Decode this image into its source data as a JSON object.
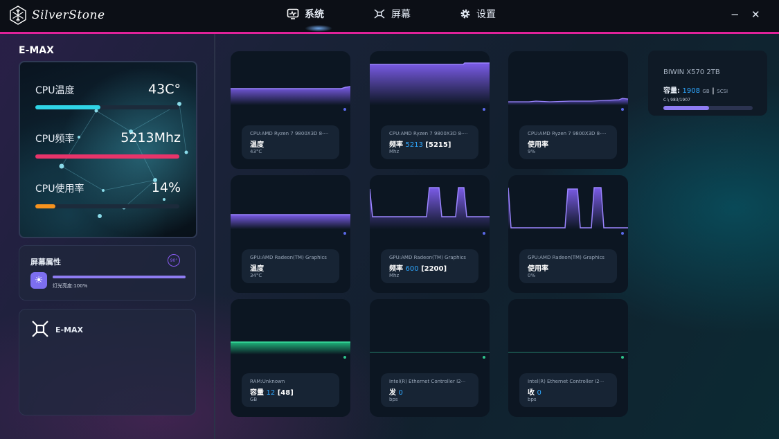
{
  "app": {
    "brand": "SilverStone",
    "colors": {
      "accent": "#e0229a",
      "cyan": "#2fd4e6",
      "pink": "#e8346a",
      "orange": "#f7931e",
      "purple": "#7b5ce8",
      "green": "#1fb47a",
      "blue": "#2fa8ff"
    }
  },
  "nav": {
    "tabs": [
      {
        "label": "系统",
        "icon": "monitor-icon"
      },
      {
        "label": "屏幕",
        "icon": "display-icon"
      },
      {
        "label": "设置",
        "icon": "gear-icon"
      }
    ],
    "active": "系统",
    "minimize": "−",
    "close": "✕"
  },
  "sidebar": {
    "device_title": "E-MAX",
    "cpu": [
      {
        "name": "CPU温度",
        "value": "43C°",
        "level": 0.45
      },
      {
        "name": "CPU频率",
        "value": "5213Mhz",
        "level": 1.0
      },
      {
        "name": "CPU使用率",
        "value": "14%",
        "level": 0.14
      }
    ],
    "screen_props": {
      "title": "屏幕属性",
      "rotate_label": "90°",
      "brightness_label": "灯光亮度:100%",
      "brightness": 1.0
    },
    "device_card": {
      "label": "E-MAX"
    }
  },
  "tiles": [
    {
      "src": "CPU:AMD Ryzen 7 9800X3D 8-···",
      "metric": "温度",
      "value": "",
      "max": "",
      "unit": "43°C"
    },
    {
      "src": "CPU:AMD Ryzen 7 9800X3D 8-···",
      "metric": "频率",
      "value": "5213",
      "max": "[5215]",
      "unit": "Mhz"
    },
    {
      "src": "CPU:AMD Ryzen 7 9800X3D 8-···",
      "metric": "使用率",
      "value": "",
      "max": "",
      "unit": "9%"
    },
    {
      "src": "GPU:AMD Radeon(TM) Graphics",
      "metric": "温度",
      "value": "",
      "max": "",
      "unit": "34°C"
    },
    {
      "src": "GPU:AMD Radeon(TM) Graphics",
      "metric": "频率",
      "value": "600",
      "max": "[2200]",
      "unit": "Mhz"
    },
    {
      "src": "GPU:AMD Radeon(TM) Graphics",
      "metric": "使用率",
      "value": "",
      "max": "",
      "unit": "0%"
    },
    {
      "src": "RAM:Unknown",
      "metric": "容量",
      "value": "12",
      "max": "[48]",
      "unit": "GB"
    },
    {
      "src": "Intel(R) Ethernet Controller I2···",
      "metric": "发",
      "value": "0",
      "max": "",
      "unit": "bps"
    },
    {
      "src": "Intel(R) Ethernet Controller I2···",
      "metric": "收",
      "value": "0",
      "max": "",
      "unit": "bps"
    }
  ],
  "disk": {
    "name": "BIWIN X570 2TB",
    "cap_label": "容量:",
    "cap_value": "1908",
    "cap_unit": "GB",
    "cap_sep": "|",
    "cap_type": "SCSI",
    "path": "C:\\ 983/1907",
    "usage": 0.515
  }
}
